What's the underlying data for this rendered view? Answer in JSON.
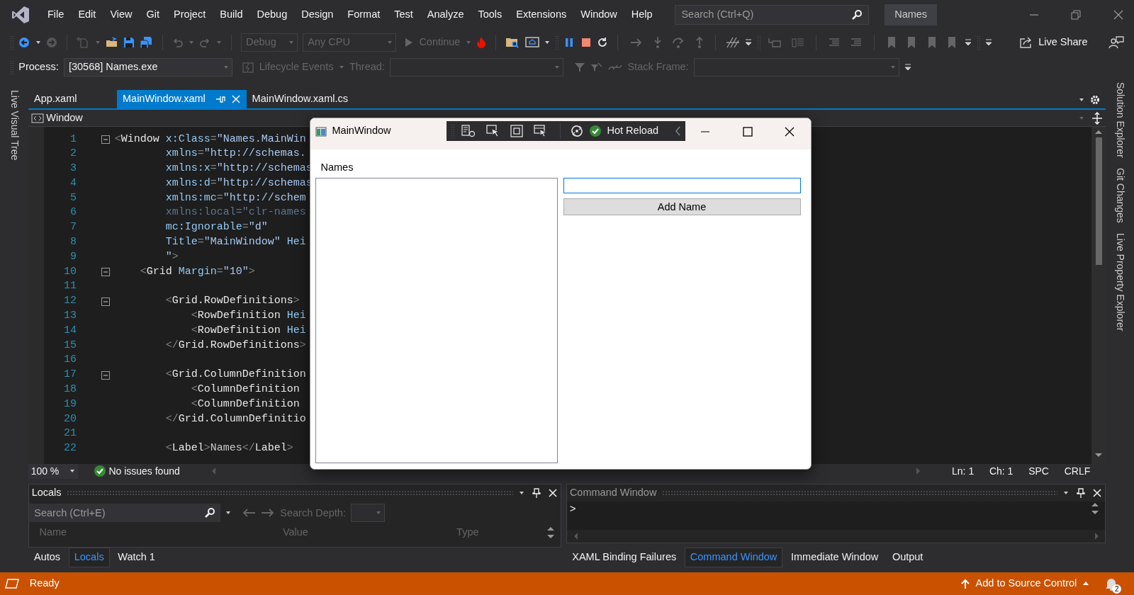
{
  "title_bar": {
    "menu": [
      "File",
      "Edit",
      "View",
      "Git",
      "Project",
      "Build",
      "Debug",
      "Design",
      "Format",
      "Test",
      "Analyze",
      "Tools",
      "Extensions",
      "Window",
      "Help"
    ],
    "search": {
      "placeholder": "Search (Ctrl+Q)"
    },
    "solution_name": "Names"
  },
  "toolbar": {
    "configuration": "Debug",
    "platform": "Any CPU",
    "continue": "Continue",
    "live_share": "Live Share"
  },
  "debug_location": {
    "process_label": "Process:",
    "process": "[30568] Names.exe",
    "lifecycle": "Lifecycle Events",
    "thread_label": "Thread:",
    "stack_frame_label": "Stack Frame:"
  },
  "side_tabs_left": [
    "Live Visual Tree"
  ],
  "side_tabs_right": [
    "Solution Explorer",
    "Git Changes",
    "Live Property Explorer"
  ],
  "document_tabs": [
    {
      "label": "App.xaml",
      "selected": false
    },
    {
      "label": "MainWindow.xaml",
      "selected": true
    },
    {
      "label": "MainWindow.xaml.cs",
      "selected": false
    }
  ],
  "editor": {
    "navigation": "Window",
    "lines": [
      {
        "number": "1",
        "fold": true,
        "parts": [
          {
            "text": "<",
            "kind": "punct"
          },
          {
            "text": "Window",
            "kind": "element"
          },
          {
            "text": " x:Class",
            "kind": "attr"
          },
          {
            "text": "=",
            "kind": "punct"
          },
          {
            "text": "\"Names.MainWin",
            "kind": "value"
          }
        ]
      },
      {
        "number": "2",
        "fold": false,
        "parts": [
          {
            "text": "        xmlns",
            "kind": "attr"
          },
          {
            "text": "=",
            "kind": "punct"
          },
          {
            "text": "\"http://schemas.",
            "kind": "value"
          }
        ]
      },
      {
        "number": "3",
        "fold": false,
        "parts": [
          {
            "text": "        xmlns:x",
            "kind": "attr"
          },
          {
            "text": "=",
            "kind": "punct"
          },
          {
            "text": "\"http://schemas",
            "kind": "value"
          }
        ]
      },
      {
        "number": "4",
        "fold": false,
        "parts": [
          {
            "text": "        xmlns:d",
            "kind": "attr"
          },
          {
            "text": "=",
            "kind": "punct"
          },
          {
            "text": "\"http://schemas",
            "kind": "value"
          }
        ]
      },
      {
        "number": "5",
        "fold": false,
        "parts": [
          {
            "text": "        xmlns:mc",
            "kind": "attr"
          },
          {
            "text": "=",
            "kind": "punct"
          },
          {
            "text": "\"http://schem",
            "kind": "value"
          }
        ]
      },
      {
        "number": "6",
        "fold": false,
        "parts": [
          {
            "text": "        xmlns:local=\"clr-names",
            "kind": "faded"
          }
        ]
      },
      {
        "number": "7",
        "fold": false,
        "parts": [
          {
            "text": "        mc:Ignorable",
            "kind": "attr"
          },
          {
            "text": "=",
            "kind": "punct"
          },
          {
            "text": "\"d\"",
            "kind": "value"
          }
        ]
      },
      {
        "number": "8",
        "fold": false,
        "parts": [
          {
            "text": "        Title",
            "kind": "attr"
          },
          {
            "text": "=",
            "kind": "punct"
          },
          {
            "text": "\"MainWindow\"",
            "kind": "value"
          },
          {
            "text": " Hei",
            "kind": "attr"
          }
        ]
      },
      {
        "number": "9",
        "fold": false,
        "parts": [
          {
            "text": "        \"",
            "kind": "value"
          },
          {
            "text": ">",
            "kind": "punct"
          }
        ]
      },
      {
        "number": "10",
        "fold": true,
        "parts": [
          {
            "text": "    <",
            "kind": "punct"
          },
          {
            "text": "Grid",
            "kind": "element"
          },
          {
            "text": " Margin",
            "kind": "attr"
          },
          {
            "text": "=",
            "kind": "punct"
          },
          {
            "text": "\"10\"",
            "kind": "value"
          },
          {
            "text": ">",
            "kind": "punct"
          }
        ]
      },
      {
        "number": "11",
        "fold": false
      },
      {
        "number": "12",
        "fold": true,
        "parts": [
          {
            "text": "        <",
            "kind": "punct"
          },
          {
            "text": "Grid.RowDefinitions",
            "kind": "element"
          },
          {
            "text": ">",
            "kind": "punct"
          }
        ]
      },
      {
        "number": "13",
        "fold": false,
        "parts": [
          {
            "text": "            <",
            "kind": "punct"
          },
          {
            "text": "RowDefinition",
            "kind": "element"
          },
          {
            "text": " Hei",
            "kind": "attr"
          }
        ]
      },
      {
        "number": "14",
        "fold": false,
        "parts": [
          {
            "text": "            <",
            "kind": "punct"
          },
          {
            "text": "RowDefinition",
            "kind": "element"
          },
          {
            "text": " Hei",
            "kind": "attr"
          }
        ]
      },
      {
        "number": "15",
        "fold": false,
        "parts": [
          {
            "text": "        </",
            "kind": "punct"
          },
          {
            "text": "Grid.RowDefinitions",
            "kind": "element"
          },
          {
            "text": ">",
            "kind": "punct"
          }
        ]
      },
      {
        "number": "16",
        "fold": false
      },
      {
        "number": "17",
        "fold": true,
        "parts": [
          {
            "text": "        <",
            "kind": "punct"
          },
          {
            "text": "Grid.ColumnDefinition",
            "kind": "element"
          }
        ]
      },
      {
        "number": "18",
        "fold": false,
        "parts": [
          {
            "text": "            <",
            "kind": "punct"
          },
          {
            "text": "ColumnDefinition",
            "kind": "element"
          }
        ]
      },
      {
        "number": "19",
        "fold": false,
        "parts": [
          {
            "text": "            <",
            "kind": "punct"
          },
          {
            "text": "ColumnDefinition",
            "kind": "element"
          }
        ]
      },
      {
        "number": "20",
        "fold": false,
        "parts": [
          {
            "text": "        </",
            "kind": "punct"
          },
          {
            "text": "Grid.ColumnDefinitio",
            "kind": "element"
          }
        ]
      },
      {
        "number": "21",
        "fold": false
      },
      {
        "number": "22",
        "fold": false,
        "parts": [
          {
            "text": "        <",
            "kind": "punct"
          },
          {
            "text": "Label",
            "kind": "element"
          },
          {
            "text": ">",
            "kind": "punct"
          },
          {
            "text": "Names",
            "kind": "content"
          },
          {
            "text": "</",
            "kind": "punct"
          },
          {
            "text": "Label",
            "kind": "element"
          },
          {
            "text": ">",
            "kind": "punct"
          }
        ]
      }
    ],
    "zoom": "100 %",
    "issues": "No issues found",
    "position": [
      "Ln: 1",
      "Ch: 1",
      "SPC",
      "CRLF"
    ]
  },
  "app_window": {
    "title": "MainWindow",
    "hot_reload": "Hot Reload",
    "label": "Names",
    "add_button": "Add Name"
  },
  "locals_panel": {
    "title": "Locals",
    "search": {
      "placeholder": "Search (Ctrl+E)"
    },
    "search_depth_label": "Search Depth:",
    "columns": [
      "Name",
      "Value",
      "Type"
    ],
    "tabs": [
      {
        "label": "Autos",
        "selected": false
      },
      {
        "label": "Locals",
        "selected": true
      },
      {
        "label": "Watch 1",
        "selected": false
      }
    ]
  },
  "command_panel": {
    "title": "Command Window",
    "prompt": ">",
    "tabs": [
      {
        "label": "XAML Binding Failures",
        "selected": false
      },
      {
        "label": "Command Window",
        "selected": true
      },
      {
        "label": "Immediate Window",
        "selected": false
      },
      {
        "label": "Output",
        "selected": false
      }
    ]
  },
  "status_bar": {
    "status": "Ready",
    "source_control": "Add to Source Control",
    "notifications": "2"
  }
}
